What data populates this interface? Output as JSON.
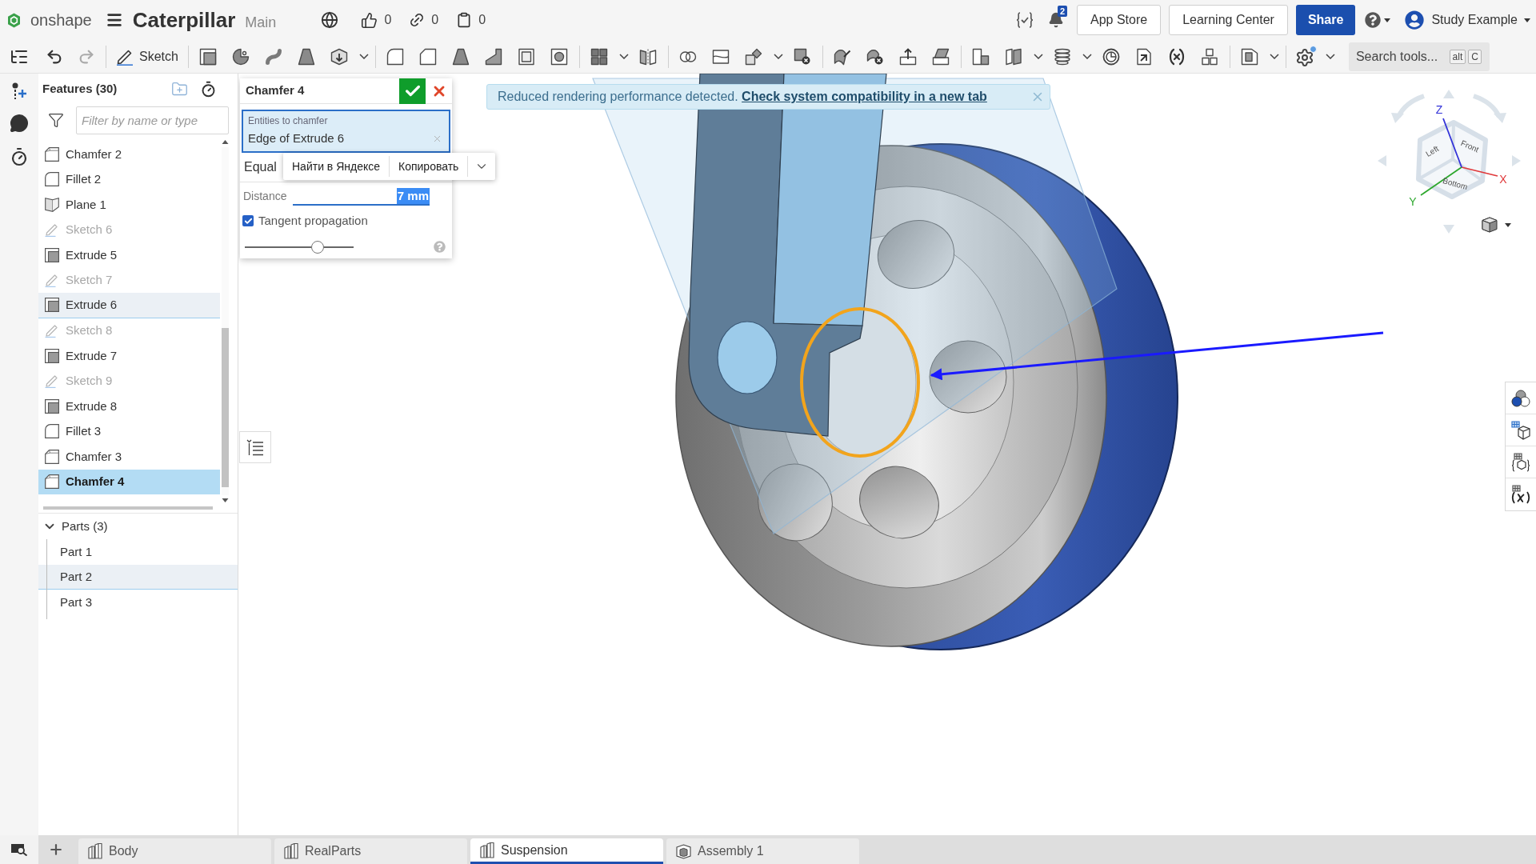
{
  "top_bar": {
    "brand": "onshape",
    "document_title": "Caterpillar",
    "branch": "Main",
    "likes": "0",
    "links": "0",
    "copies": "0",
    "notification_count": "2",
    "buttons": [
      {
        "label": "App Store",
        "kind": "outline"
      },
      {
        "label": "Learning Center",
        "kind": "outline"
      },
      {
        "label": "Share",
        "kind": "primary"
      }
    ],
    "user": "Study Example"
  },
  "toolbar": {
    "sketch_label": "Sketch",
    "search": {
      "placeholder": "Search tools...",
      "shortcut": [
        "alt",
        "C"
      ]
    }
  },
  "features_panel": {
    "title": "Features (30)",
    "filter": {
      "placeholder": "Filter by name or type"
    },
    "items": [
      {
        "label": "Chamfer 2",
        "kind": "chamfer",
        "selected": false,
        "highlighted": false
      },
      {
        "label": "Fillet 2",
        "kind": "fillet",
        "selected": false,
        "highlighted": false
      },
      {
        "label": "Plane 1",
        "kind": "plane",
        "selected": false,
        "highlighted": false
      },
      {
        "label": "Sketch 6",
        "kind": "sketch",
        "selected": false,
        "highlighted": false
      },
      {
        "label": "Extrude 5",
        "kind": "extrude",
        "selected": false,
        "highlighted": false
      },
      {
        "label": "Sketch 7",
        "kind": "sketch",
        "selected": false,
        "highlighted": false
      },
      {
        "label": "Extrude 6",
        "kind": "extrude",
        "selected": false,
        "highlighted": true
      },
      {
        "label": "Sketch 8",
        "kind": "sketch",
        "selected": false,
        "highlighted": false
      },
      {
        "label": "Extrude 7",
        "kind": "extrude",
        "selected": false,
        "highlighted": false
      },
      {
        "label": "Sketch 9",
        "kind": "sketch",
        "selected": false,
        "highlighted": false
      },
      {
        "label": "Extrude 8",
        "kind": "extrude",
        "selected": false,
        "highlighted": false
      },
      {
        "label": "Fillet 3",
        "kind": "fillet",
        "selected": false,
        "highlighted": false
      },
      {
        "label": "Chamfer 3",
        "kind": "chamfer",
        "selected": false,
        "highlighted": false
      },
      {
        "label": "Chamfer 4",
        "kind": "chamfer",
        "selected": true,
        "highlighted": false
      }
    ],
    "parts": {
      "label": "Parts (3)",
      "expanded": true,
      "children": [
        {
          "label": "Part 1",
          "highlighted": false
        },
        {
          "label": "Part 2",
          "highlighted": true
        },
        {
          "label": "Part 3",
          "highlighted": false
        }
      ]
    }
  },
  "feature_dialog": {
    "title": "Chamfer 4",
    "entities": {
      "label": "Entities to chamfer",
      "value": "Edge of Extrude 6"
    },
    "measurement": "Equal",
    "distance": {
      "label": "Distance",
      "value": "7 mm",
      "selected": true
    },
    "tangent_propagation": {
      "label": "Tangent propagation",
      "checked": true
    },
    "slider": {
      "level": 0.69
    }
  },
  "context_menu": {
    "items": [
      {
        "label": "Найти в Яндексе"
      },
      {
        "label": "Копировать"
      }
    ]
  },
  "banner": {
    "message": "Reduced rendering performance detected.",
    "link": "Check system compatibility in a new tab"
  },
  "view_cube": {
    "faces": [
      {
        "label": "Left"
      },
      {
        "label": "Front"
      },
      {
        "label": "Bottom"
      }
    ],
    "axes": [
      {
        "label": "X",
        "color": "#e0393b"
      },
      {
        "label": "Y",
        "color": "#2ea82e"
      },
      {
        "label": "Z",
        "color": "#3232d8"
      }
    ]
  },
  "tabs": [
    {
      "label": "Body",
      "kind": "part_studio",
      "selected": false
    },
    {
      "label": "RealParts",
      "kind": "part_studio",
      "selected": false
    },
    {
      "label": "Suspension",
      "kind": "part_studio",
      "selected": true
    },
    {
      "label": "Assembly 1",
      "kind": "assembly",
      "selected": false
    }
  ]
}
